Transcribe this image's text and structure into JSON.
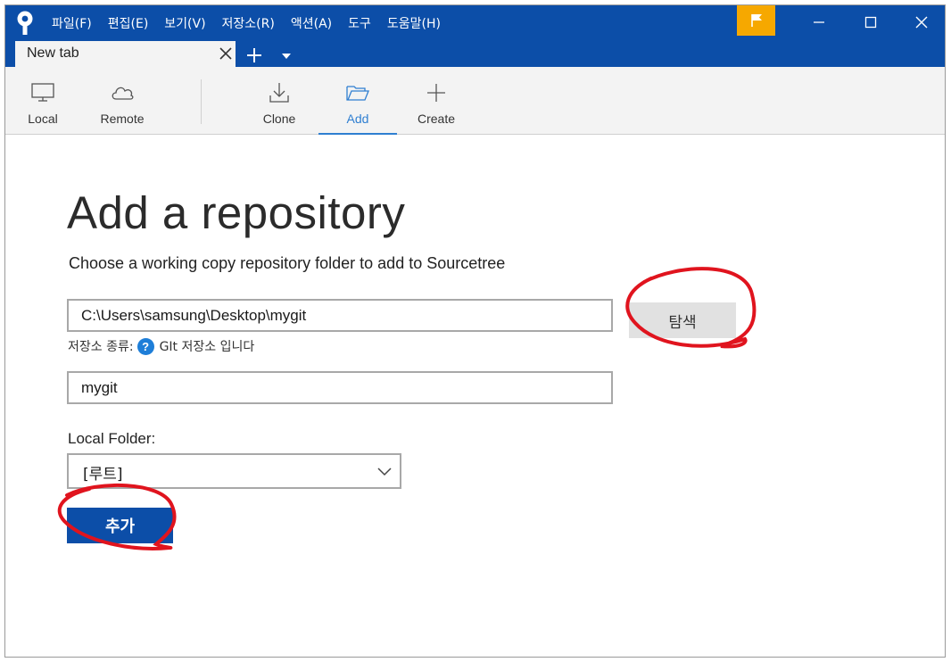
{
  "menu": [
    "파일(F)",
    "편집(E)",
    "보기(V)",
    "저장소(R)",
    "액션(A)",
    "도구",
    "도움말(H)"
  ],
  "tab": {
    "label": "New tab"
  },
  "toolbar": {
    "local": "Local",
    "remote": "Remote",
    "clone": "Clone",
    "add": "Add",
    "create": "Create"
  },
  "main": {
    "title": "Add a repository",
    "subtitle": "Choose a working copy repository folder to add to Sourcetree",
    "path_value": "C:\\Users\\samsung\\Desktop\\mygit",
    "browse_label": "탐색",
    "repo_type_prefix": "저장소 종류:",
    "repo_type_help": "?",
    "repo_type_value": "GIt 저장소 입니다",
    "name_value": "mygit",
    "local_folder_label": "Local Folder:",
    "local_folder_value": "[루트]",
    "add_button": "추가"
  },
  "colors": {
    "titlebar": "#0c4ea8",
    "flag": "#f6a800",
    "accent": "#2f7fd1",
    "annotation": "#e0141e"
  },
  "icons": [
    "sourcetree-logo-icon",
    "flag-icon",
    "minimize-icon",
    "maximize-icon",
    "close-icon",
    "plus-icon",
    "chevron-down-icon",
    "monitor-icon",
    "cloud-icon",
    "download-icon",
    "folder-open-icon",
    "help-icon"
  ]
}
